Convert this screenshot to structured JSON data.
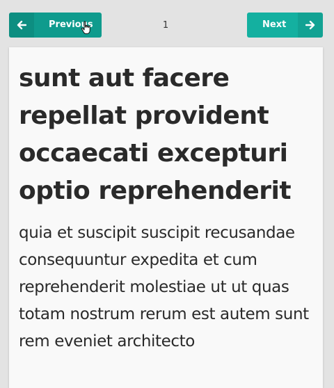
{
  "pagination": {
    "prev_label": "Previous",
    "next_label": "Next",
    "current_page": "1"
  },
  "icons": {
    "prev": "arrow-left-icon",
    "next": "arrow-right-icon",
    "cursor": "hand-pointer-cursor-icon"
  },
  "colors": {
    "accent": "#14b0a0",
    "accent_pressed": "#0f9b8d",
    "background": "#e3e3e3",
    "card": "#f9f9f9",
    "text": "#2a2a2a"
  },
  "post": {
    "title": "sunt aut facere repellat provident occaecati excepturi optio reprehenderit",
    "body": "quia et suscipit suscipit recusandae consequuntur expedita et cum reprehenderit molestiae ut ut quas totam nostrum rerum est autem sunt rem eveniet architecto"
  }
}
